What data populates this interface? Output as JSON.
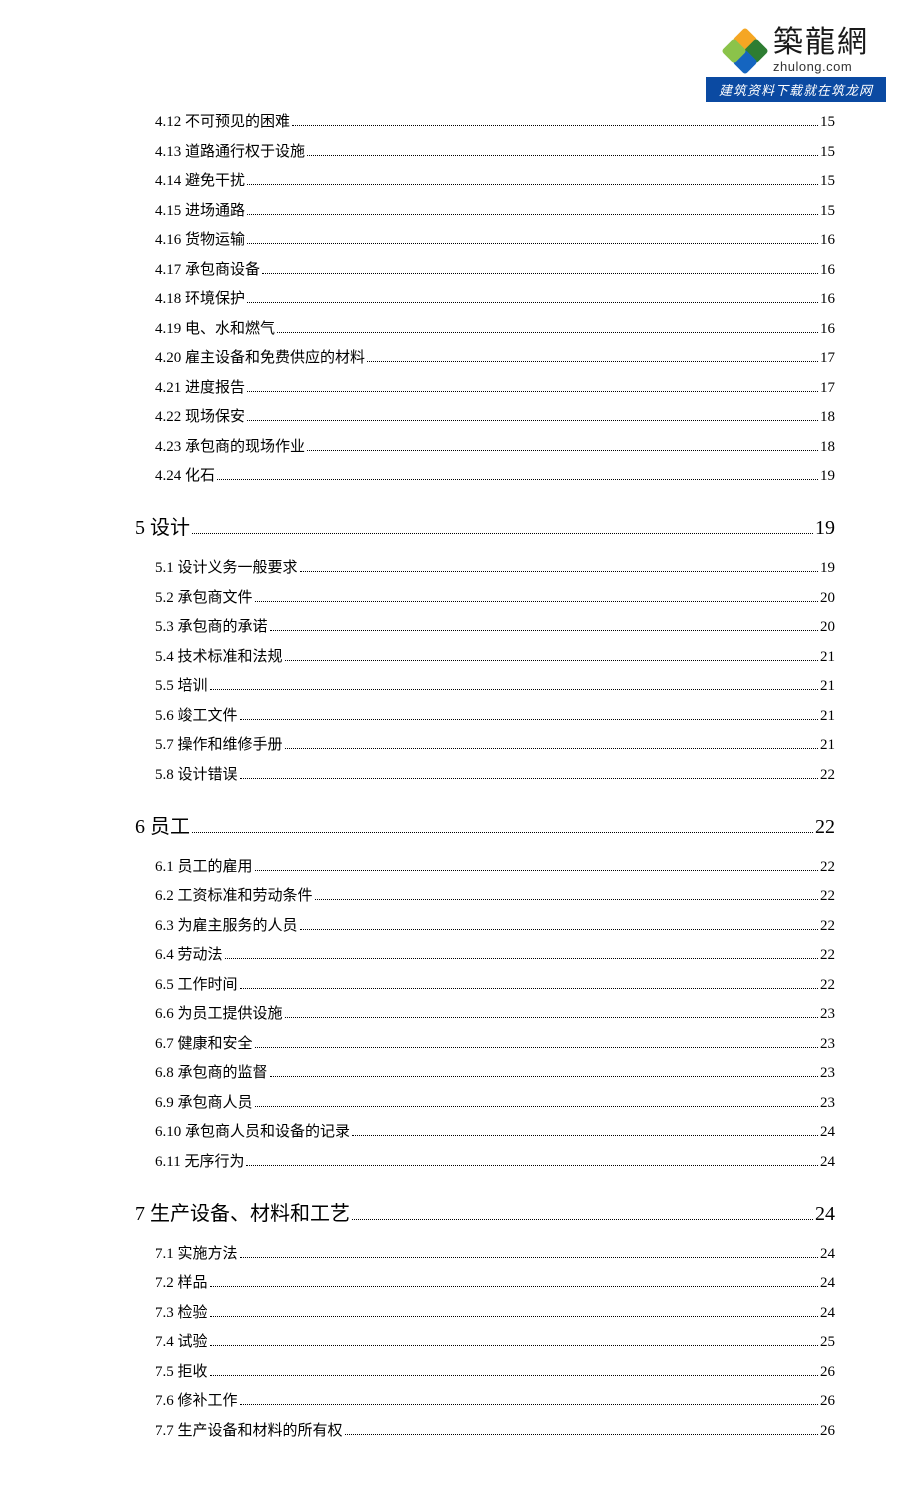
{
  "logo": {
    "cn": "築龍網",
    "en": "zhulong.com",
    "bar": "建筑资料下载就在筑龙网"
  },
  "toc": [
    {
      "level": 2,
      "label": "4.12 不可预见的困难",
      "page": "15"
    },
    {
      "level": 2,
      "label": "4.13 道路通行权于设施",
      "page": "15"
    },
    {
      "level": 2,
      "label": "4.14 避免干扰",
      "page": "15"
    },
    {
      "level": 2,
      "label": "4.15 进场通路",
      "page": "15"
    },
    {
      "level": 2,
      "label": "4.16 货物运输",
      "page": "16"
    },
    {
      "level": 2,
      "label": "4.17 承包商设备",
      "page": "16"
    },
    {
      "level": 2,
      "label": "4.18 环境保护",
      "page": "16"
    },
    {
      "level": 2,
      "label": "4.19 电、水和燃气",
      "page": "16"
    },
    {
      "level": 2,
      "label": "4.20 雇主设备和免费供应的材料",
      "page": "17"
    },
    {
      "level": 2,
      "label": "4.21 进度报告",
      "page": "17"
    },
    {
      "level": 2,
      "label": "4.22 现场保安",
      "page": "18"
    },
    {
      "level": 2,
      "label": "4.23 承包商的现场作业",
      "page": "18"
    },
    {
      "level": 2,
      "label": "4.24 化石",
      "page": "19"
    },
    {
      "level": 1,
      "label": "5 设计",
      "page": "19"
    },
    {
      "level": 2,
      "label": "5.1 设计义务一般要求",
      "page": "19"
    },
    {
      "level": 2,
      "label": "5.2 承包商文件",
      "page": "20"
    },
    {
      "level": 2,
      "label": "5.3 承包商的承诺",
      "page": "20"
    },
    {
      "level": 2,
      "label": "5.4 技术标准和法规",
      "page": "21"
    },
    {
      "level": 2,
      "label": "5.5 培训",
      "page": "21"
    },
    {
      "level": 2,
      "label": "5.6 竣工文件",
      "page": "21"
    },
    {
      "level": 2,
      "label": "5.7 操作和维修手册",
      "page": "21"
    },
    {
      "level": 2,
      "label": "5.8 设计错误",
      "page": "22"
    },
    {
      "level": 1,
      "label": "6 员工",
      "page": "22"
    },
    {
      "level": 2,
      "label": "6.1 员工的雇用",
      "page": "22"
    },
    {
      "level": 2,
      "label": "6.2 工资标准和劳动条件",
      "page": "22"
    },
    {
      "level": 2,
      "label": "6.3 为雇主服务的人员",
      "page": "22"
    },
    {
      "level": 2,
      "label": "6.4  劳动法",
      "page": "22"
    },
    {
      "level": 2,
      "label": "6.5  工作时间",
      "page": "22"
    },
    {
      "level": 2,
      "label": "6.6 为员工提供设施",
      "page": "23"
    },
    {
      "level": 2,
      "label": "6.7 健康和安全",
      "page": "23"
    },
    {
      "level": 2,
      "label": "6.8 承包商的监督",
      "page": "23"
    },
    {
      "level": 2,
      "label": "6.9 承包商人员",
      "page": "23"
    },
    {
      "level": 2,
      "label": "6.10 承包商人员和设备的记录",
      "page": "24"
    },
    {
      "level": 2,
      "label": "6.11 无序行为",
      "page": "24"
    },
    {
      "level": 1,
      "label": "7 生产设备、材料和工艺",
      "page": "24"
    },
    {
      "level": 2,
      "label": "7.1 实施方法",
      "page": "24"
    },
    {
      "level": 2,
      "label": "7.2 样品",
      "page": "24"
    },
    {
      "level": 2,
      "label": "7.3 检验",
      "page": "24"
    },
    {
      "level": 2,
      "label": "7.4 试验",
      "page": "25"
    },
    {
      "level": 2,
      "label": "7.5 拒收",
      "page": "26"
    },
    {
      "level": 2,
      "label": "7.6 修补工作",
      "page": "26"
    },
    {
      "level": 2,
      "label": "7.7 生产设备和材料的所有权",
      "page": "26"
    }
  ]
}
